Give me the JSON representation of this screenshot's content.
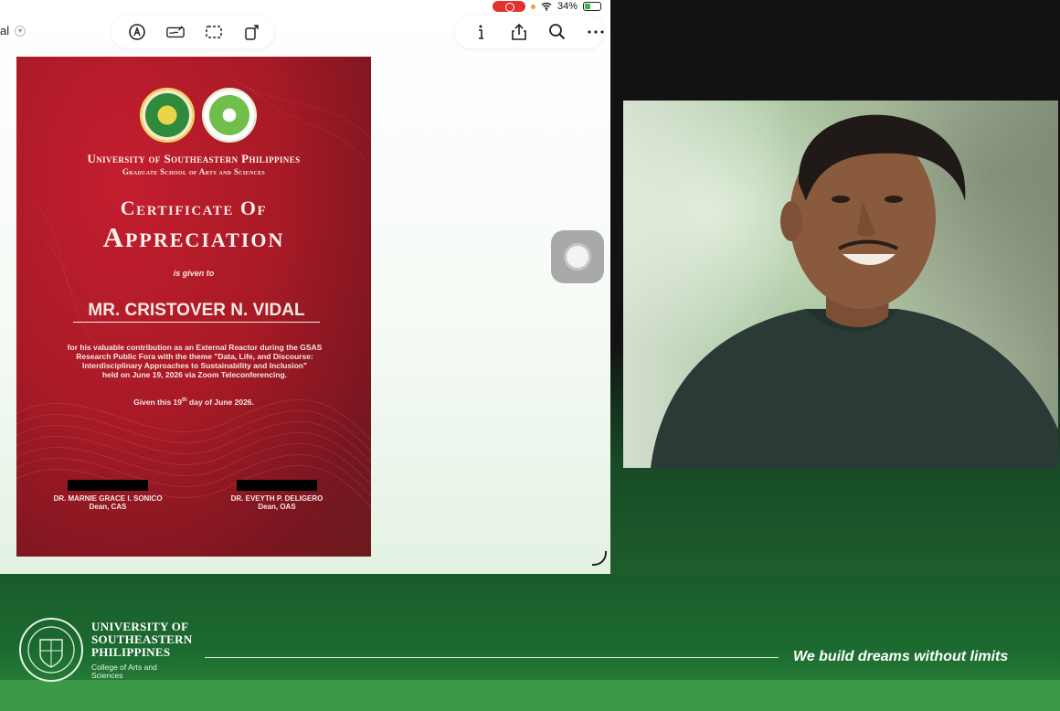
{
  "status_bar": {
    "battery_percent": "34%"
  },
  "document": {
    "name_fragment": "al"
  },
  "certificate": {
    "university": "University of Southeastern Philippines",
    "school": "Graduate School of Arts and Sciences",
    "title_line1": "Certificate Of",
    "title_line2": "Appreciation",
    "given_to": "is given to",
    "recipient": "MR. CRISTOVER N. VIDAL",
    "body_line1": "for his valuable contribution as an External Reactor during the GSAS",
    "body_line2": "Research Public Fora with the theme \"Data, Life, and Discourse:",
    "body_line3": "Interdisciplinary Approaches to Sustainability and Inclusion\"",
    "body_line4": "held on June 19, 2026 via Zoom Teleconferencing.",
    "date_prefix": "Given this 19",
    "date_sup": "th",
    "date_suffix": " day of June 2026.",
    "signatories": [
      {
        "name": "DR. MARNIE GRACE I. SONICO",
        "title": "Dean, CAS"
      },
      {
        "name": "DR. EVEYTH P. DELIGERO",
        "title": "Dean, OAS"
      }
    ]
  },
  "footer": {
    "univ_line1": "UNIVERSITY OF",
    "univ_line2": "SOUTHEASTERN",
    "univ_line3": "PHILIPPINES",
    "college": "College of Arts and Sciences",
    "tagline": "We build dreams without limits"
  },
  "colors": {
    "certificate_red": "#a81a26",
    "banner_green": "#1b6a2f",
    "record_red": "#e1342f"
  }
}
